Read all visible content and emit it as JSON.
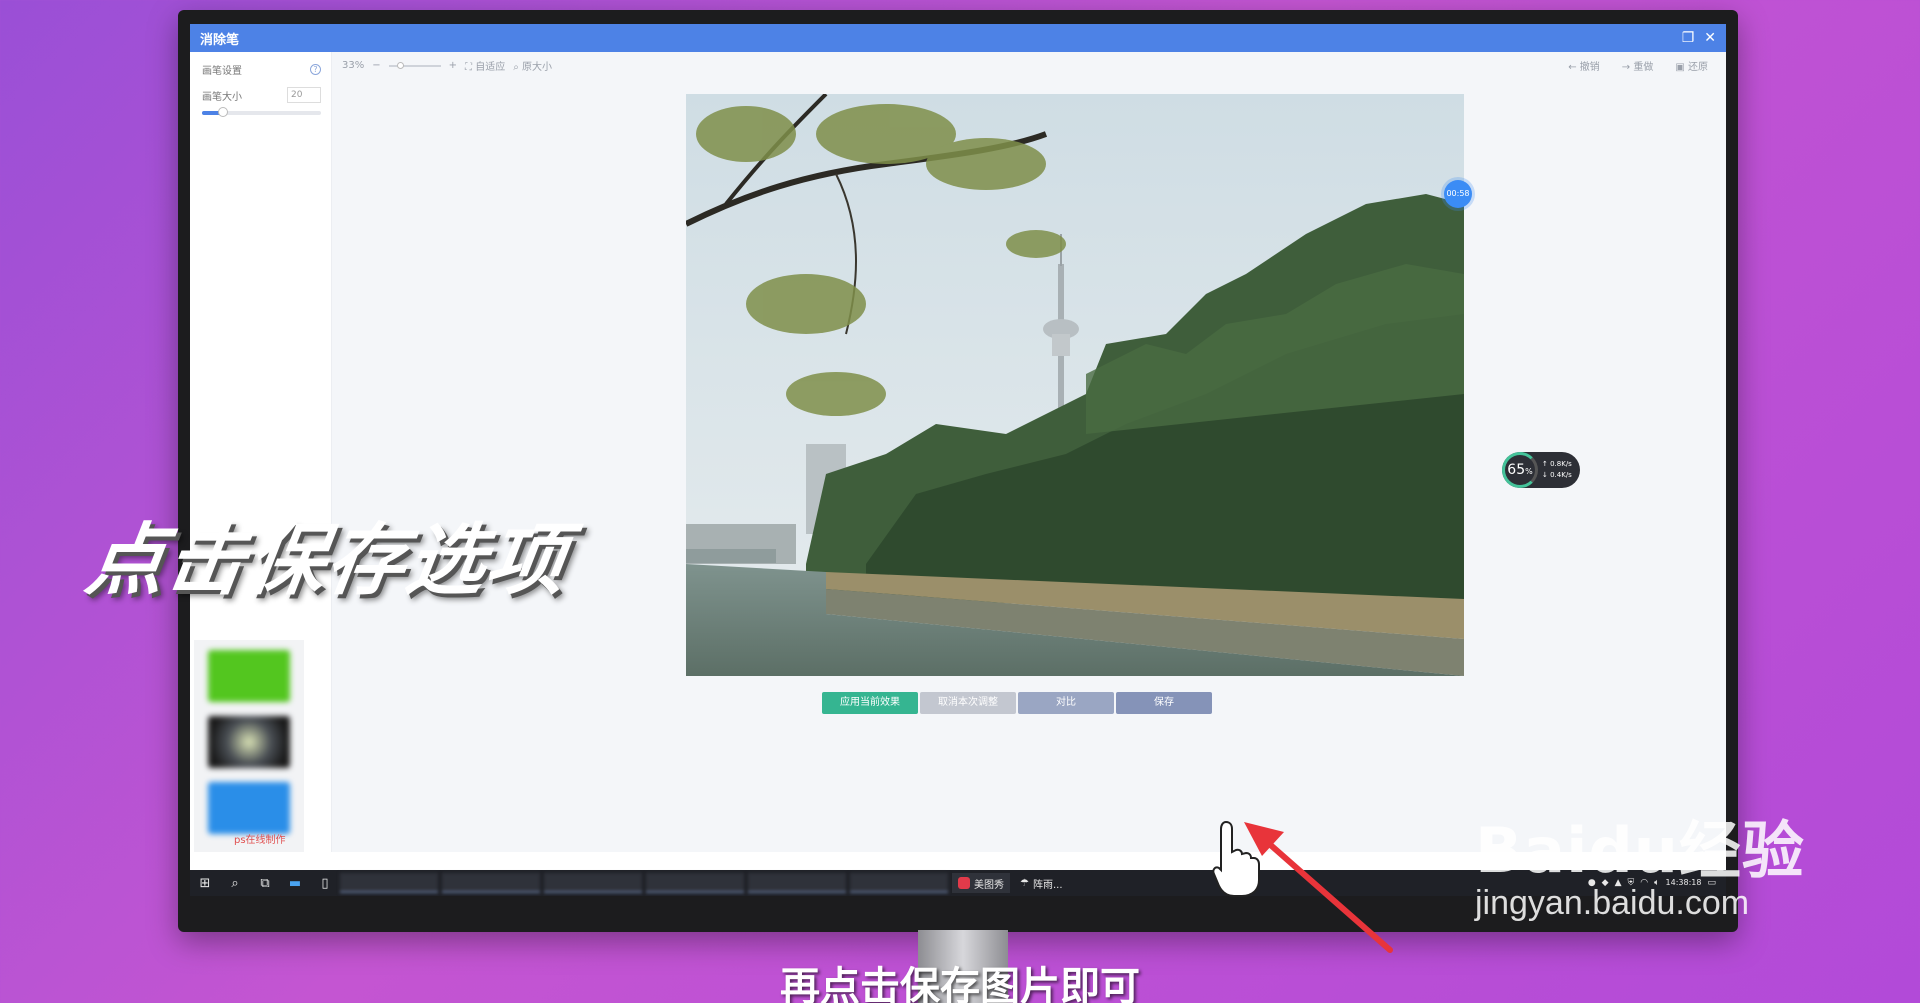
{
  "window": {
    "title": "消除笔",
    "restore_icon": "❐",
    "close_icon": "✕"
  },
  "left_panel": {
    "section_title": "画笔设置",
    "brush_size_label": "画笔大小",
    "brush_size_value": "20",
    "thumbnail_caption": "ps在线制作"
  },
  "toolbar": {
    "zoom_percent": "33%",
    "minus": "−",
    "plus": "+",
    "fit_label": "自适应",
    "original_label": "原大小",
    "undo_label": "撤销",
    "redo_label": "重做",
    "restore_label": "还原"
  },
  "floating": {
    "timer": "00:58",
    "net_percent": "65",
    "net_unit": "%",
    "upload_rate": "0.8K/s",
    "download_rate": "0.4K/s"
  },
  "actions": {
    "apply_label": "应用当前效果",
    "cancel_label": "取消本次调整",
    "compare_label": "对比",
    "save_label": "保存"
  },
  "taskbar": {
    "app_meitu": "美图秀",
    "app_rain": "阵雨...",
    "clock_time": "14:38:18"
  },
  "overlay": {
    "caption": "点击保存选项",
    "subtitle": "再点击保存图片即可",
    "watermark_logo": "Baidu经验",
    "watermark_url": "jingyan.baidu.com"
  }
}
